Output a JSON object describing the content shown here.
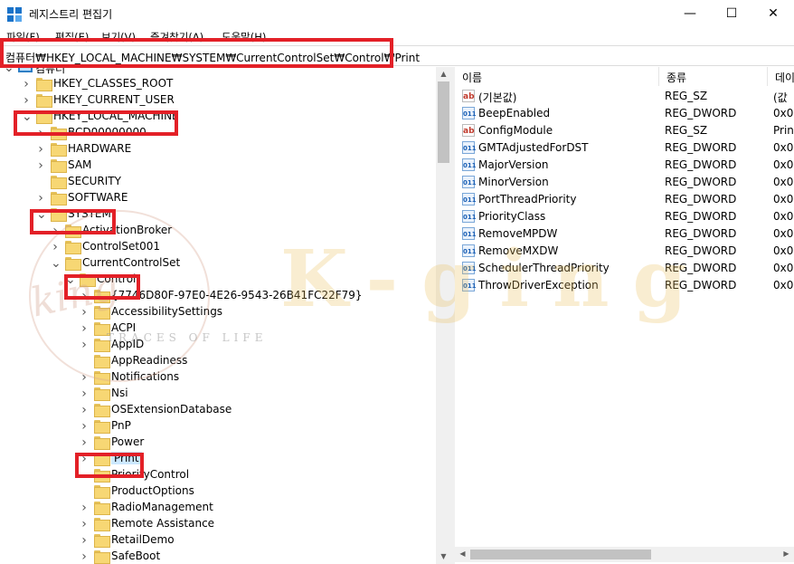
{
  "window": {
    "title": "레지스트리 편집기",
    "min_glyph": "—",
    "max_glyph": "☐",
    "close_glyph": "✕"
  },
  "menu": [
    "파일(F)",
    "편집(E)",
    "보기(V)",
    "즐겨찾기(A)",
    "도움말(H)"
  ],
  "address": "컴퓨터₩HKEY_LOCAL_MACHINE₩SYSTEM₩CurrentControlSet₩Control₩Print",
  "tree": [
    {
      "label": "컴퓨터",
      "icon": "computer-icon",
      "expander": "expanded"
    },
    {
      "label": "HKEY_CLASSES_ROOT",
      "icon": "folder-icon",
      "expander": "collapsed"
    },
    {
      "label": "HKEY_CURRENT_USER",
      "icon": "folder-icon",
      "expander": "collapsed"
    },
    {
      "label": "HKEY_LOCAL_MACHINE",
      "icon": "folder-icon",
      "expander": "expanded"
    },
    {
      "label": "BCD00000000",
      "icon": "folder-icon",
      "expander": "collapsed"
    },
    {
      "label": "HARDWARE",
      "icon": "folder-icon",
      "expander": "collapsed"
    },
    {
      "label": "SAM",
      "icon": "folder-icon",
      "expander": "collapsed"
    },
    {
      "label": "SECURITY",
      "icon": "folder-icon",
      "expander": "none"
    },
    {
      "label": "SOFTWARE",
      "icon": "folder-icon",
      "expander": "collapsed"
    },
    {
      "label": "SYSTEM",
      "icon": "folder-icon",
      "expander": "expanded"
    },
    {
      "label": "ActivationBroker",
      "icon": "folder-icon",
      "expander": "collapsed"
    },
    {
      "label": "ControlSet001",
      "icon": "folder-icon",
      "expander": "collapsed"
    },
    {
      "label": "CurrentControlSet",
      "icon": "folder-icon",
      "expander": "expanded"
    },
    {
      "label": "Control",
      "icon": "folder-open-icon",
      "expander": "expanded"
    },
    {
      "label": "{7746D80F-97E0-4E26-9543-26B41FC22F79}",
      "icon": "folder-icon",
      "expander": "collapsed"
    },
    {
      "label": "AccessibilitySettings",
      "icon": "folder-icon",
      "expander": "collapsed"
    },
    {
      "label": "ACPI",
      "icon": "folder-icon",
      "expander": "collapsed"
    },
    {
      "label": "AppID",
      "icon": "folder-icon",
      "expander": "collapsed"
    },
    {
      "label": "AppReadiness",
      "icon": "folder-icon",
      "expander": "none"
    },
    {
      "label": "Notifications",
      "icon": "folder-icon",
      "expander": "collapsed"
    },
    {
      "label": "Nsi",
      "icon": "folder-icon",
      "expander": "collapsed"
    },
    {
      "label": "OSExtensionDatabase",
      "icon": "folder-icon",
      "expander": "collapsed"
    },
    {
      "label": "PnP",
      "icon": "folder-icon",
      "expander": "collapsed"
    },
    {
      "label": "Power",
      "icon": "folder-icon",
      "expander": "collapsed"
    },
    {
      "label": "Print",
      "icon": "folder-icon",
      "expander": "collapsed",
      "selected": true
    },
    {
      "label": "PriorityControl",
      "icon": "folder-icon",
      "expander": "none"
    },
    {
      "label": "ProductOptions",
      "icon": "folder-icon",
      "expander": "none"
    },
    {
      "label": "RadioManagement",
      "icon": "folder-icon",
      "expander": "collapsed"
    },
    {
      "label": "Remote Assistance",
      "icon": "folder-icon",
      "expander": "collapsed"
    },
    {
      "label": "RetailDemo",
      "icon": "folder-icon",
      "expander": "collapsed"
    },
    {
      "label": "SafeBoot",
      "icon": "folder-icon",
      "expander": "collapsed"
    }
  ],
  "list": {
    "columns": [
      "이름",
      "종류",
      "데이"
    ],
    "rows": [
      {
        "icon": "string-value-icon",
        "name": "(기본값)",
        "type": "REG_SZ",
        "data": "(값"
      },
      {
        "icon": "dword-value-icon",
        "name": "BeepEnabled",
        "type": "REG_DWORD",
        "data": "0x0"
      },
      {
        "icon": "string-value-icon",
        "name": "ConfigModule",
        "type": "REG_SZ",
        "data": "Prin"
      },
      {
        "icon": "dword-value-icon",
        "name": "GMTAdjustedForDST",
        "type": "REG_DWORD",
        "data": "0x0"
      },
      {
        "icon": "dword-value-icon",
        "name": "MajorVersion",
        "type": "REG_DWORD",
        "data": "0x0"
      },
      {
        "icon": "dword-value-icon",
        "name": "MinorVersion",
        "type": "REG_DWORD",
        "data": "0x0"
      },
      {
        "icon": "dword-value-icon",
        "name": "PortThreadPriority",
        "type": "REG_DWORD",
        "data": "0x0"
      },
      {
        "icon": "dword-value-icon",
        "name": "PriorityClass",
        "type": "REG_DWORD",
        "data": "0x0"
      },
      {
        "icon": "dword-value-icon",
        "name": "RemoveMPDW",
        "type": "REG_DWORD",
        "data": "0x0"
      },
      {
        "icon": "dword-value-icon",
        "name": "RemoveMXDW",
        "type": "REG_DWORD",
        "data": "0x0"
      },
      {
        "icon": "dword-value-icon",
        "name": "SchedulerThreadPriority",
        "type": "REG_DWORD",
        "data": "0x0"
      },
      {
        "icon": "dword-value-icon",
        "name": "ThrowDriverException",
        "type": "REG_DWORD",
        "data": "0x0"
      }
    ]
  },
  "icon_glyphs": {
    "string": "ab",
    "dword": "011"
  },
  "watermark": {
    "main": "K-ging",
    "script": "king",
    "tagline": "TRACES OF LIFE"
  },
  "colors": {
    "highlight": "#e32027",
    "selection": "#cce8ff",
    "folder": "#f7d774"
  }
}
